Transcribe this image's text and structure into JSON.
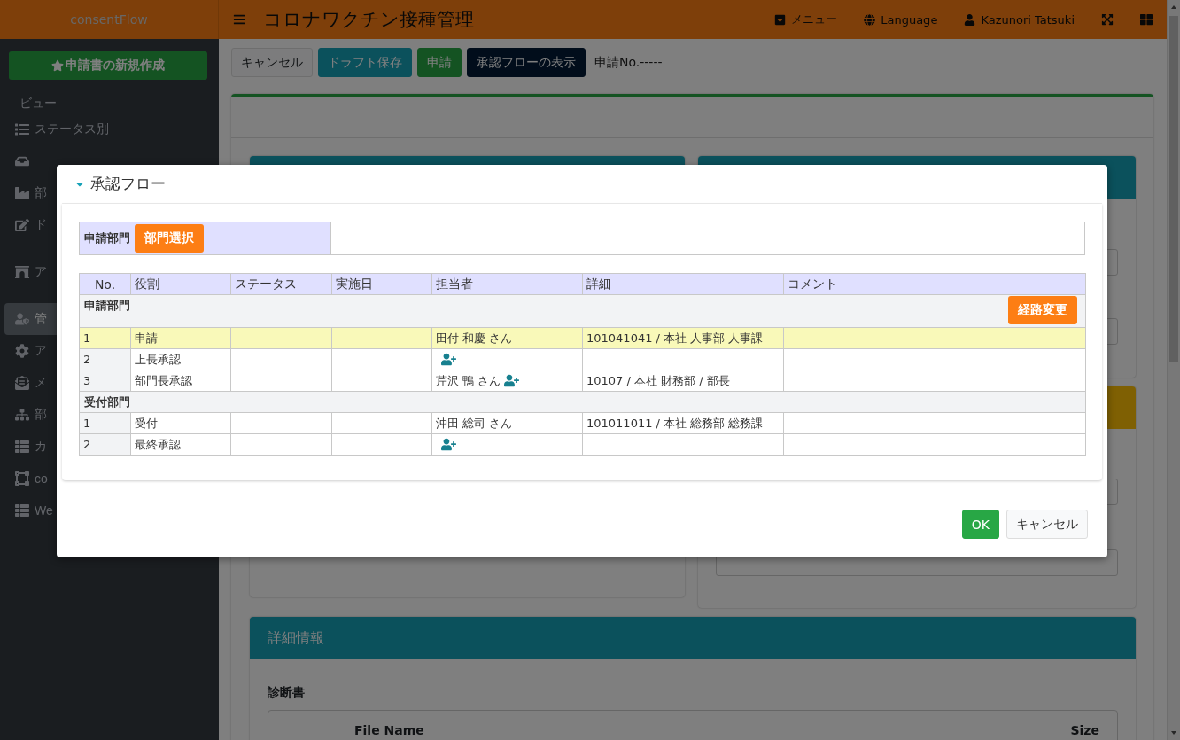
{
  "app": {
    "brand": "consentFlow",
    "title": "コロナワクチン接種管理",
    "nav": [
      {
        "kind": "menu",
        "label": "メニュー"
      },
      {
        "kind": "language",
        "label": "Language"
      },
      {
        "kind": "user",
        "label": "Kazunori Tatsuki"
      },
      {
        "kind": "fullscreen"
      },
      {
        "kind": "apps"
      }
    ]
  },
  "sidebar": {
    "new_button": "申請書の新規作成",
    "section": "ビュー",
    "groups": [
      {
        "items": [
          {
            "label": "ステータス別",
            "selected": false
          },
          {
            "selected": false
          },
          {
            "label": "部",
            "selected": false
          },
          {
            "label": "ド",
            "selected": false
          }
        ]
      },
      {
        "items": [
          {
            "label": "ア",
            "selected": false
          }
        ]
      },
      {
        "items": [
          {
            "label": "管",
            "selected": true
          },
          {
            "label": "ア",
            "selected": false
          },
          {
            "label": "メ",
            "selected": false
          },
          {
            "label": "部",
            "selected": false
          },
          {
            "label": "カ",
            "selected": false
          },
          {
            "label": "co",
            "selected": false
          },
          {
            "label": "We",
            "selected": false
          }
        ]
      }
    ]
  },
  "toolbar": {
    "buttons": [
      {
        "label": "キャンセル",
        "kind": "light"
      },
      {
        "label": "ドラフト保存",
        "kind": "info"
      },
      {
        "label": "申請",
        "kind": "success"
      },
      {
        "label": "承認フローの表示",
        "kind": "dark"
      }
    ],
    "application_no": "申請No.-----"
  },
  "detail_section": {
    "title": "詳細情報",
    "subtitle": "診断書",
    "columns": [
      "File Name",
      "Size"
    ]
  },
  "dialog": {
    "title": "承認フロー",
    "department": {
      "label": "申請部門",
      "button": "部門選択"
    },
    "columns": [
      "No.",
      "役割",
      "ステータス",
      "実施日",
      "担当者",
      "詳細",
      "コメント"
    ],
    "groups": [
      {
        "name": "申請部門",
        "button": "経路変更",
        "rows": [
          {
            "no": "1",
            "role": "申請",
            "assignee": "田付 和慶 さん",
            "add_assignee": false,
            "detail": "101041041 / 本社 人事部 人事課",
            "selected": true
          },
          {
            "no": "2",
            "role": "上長承認",
            "add_assignee": true,
            "selected": false
          },
          {
            "no": "3",
            "role": "部門長承認",
            "assignee": "芹沢 鴨 さん",
            "add_assignee": true,
            "detail": "10107 / 本社 財務部 / 部長",
            "selected": false
          }
        ]
      },
      {
        "name": "受付部門",
        "rows": [
          {
            "no": "1",
            "role": "受付",
            "assignee": "沖田 総司 さん",
            "add_assignee": false,
            "detail": "101011011 / 本社 総務部 総務課",
            "selected": false
          },
          {
            "no": "2",
            "role": "最終承認",
            "add_assignee": true,
            "selected": false
          }
        ]
      }
    ],
    "buttons": [
      {
        "label": "OK",
        "kind": "primary"
      },
      {
        "label": "キャンセル",
        "kind": "secondary"
      }
    ]
  }
}
